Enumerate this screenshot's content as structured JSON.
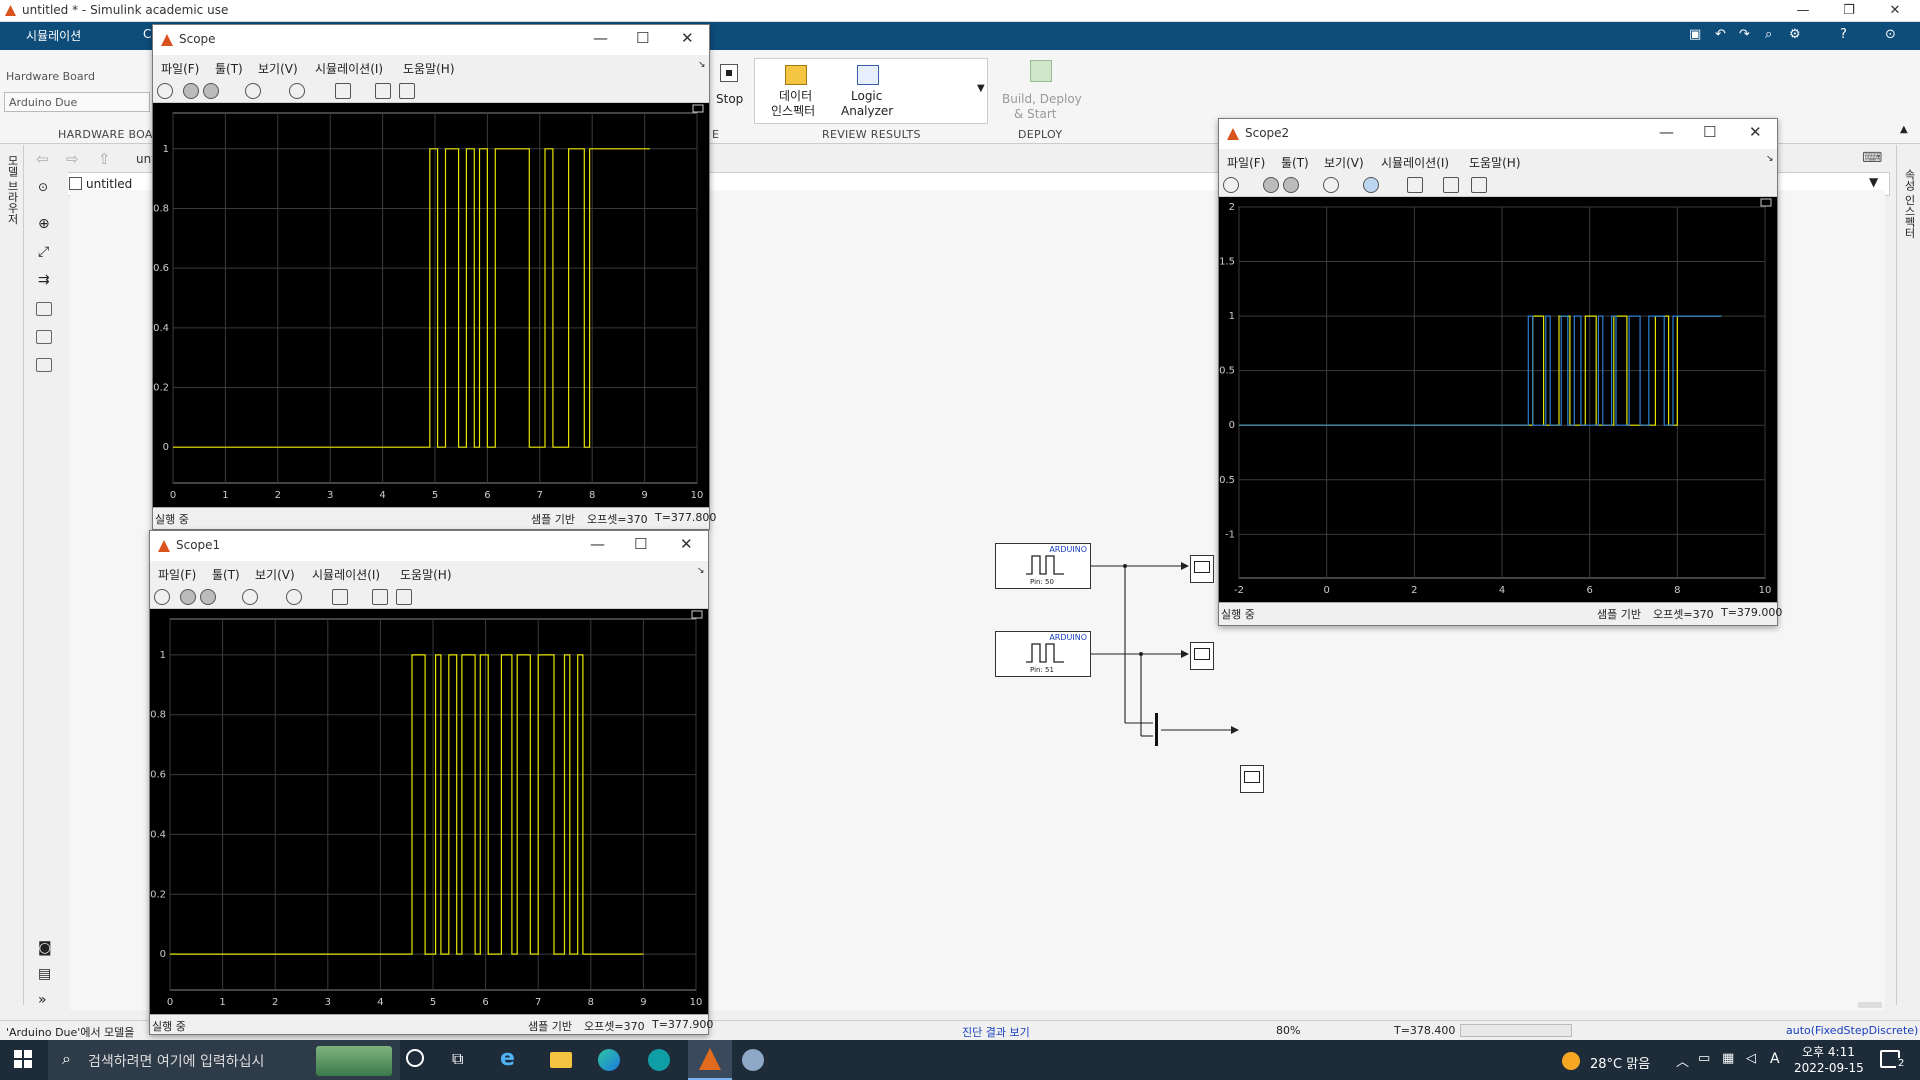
{
  "app": {
    "title": "untitled * - Simulink academic use"
  },
  "ribbon": {
    "tabs": [
      "시뮬레이션",
      "C"
    ],
    "hardware_board_label": "Hardware Board",
    "hardware_board_value": "Arduino Due",
    "hardware_section": "HARDWARE BOA",
    "stop_label": "Stop",
    "data_inspector_line1": "데이터",
    "data_inspector_line2": "인스펙터",
    "logic_analyzer_line1": "Logic",
    "logic_analyzer_line2": "Analyzer",
    "review_section": "REVIEW RESULTS",
    "build_line1": "Build, Deploy",
    "build_line2": "& Start",
    "deploy_section": "DEPLOY",
    "pipe_section": "E"
  },
  "left_rail_text": "모델 브라우저",
  "right_rail_text": "속성 인스펙터",
  "address": {
    "crumb": "untitled",
    "crumb_top": "unt"
  },
  "status": {
    "message": "'Arduino Due'에서 모델을",
    "diagnostics": "진단 결과 보기",
    "zoom": "80%",
    "time": "T=378.400",
    "solver": "auto(FixedStepDiscrete)"
  },
  "menus": [
    "파일(F)",
    "툴(T)",
    "보기(V)",
    "시뮬레이션(I)",
    "도움말(H)"
  ],
  "scope": {
    "title": "Scope",
    "status": "실행 중",
    "sample": "샘플 기반",
    "offset": "오프셋=370",
    "time": "T=377.800",
    "xticks": [
      "0",
      "1",
      "2",
      "3",
      "4",
      "5",
      "6",
      "7",
      "8",
      "9",
      "10"
    ],
    "yticks": [
      "0",
      "0.2",
      "0.4",
      "0.6",
      "0.8",
      "1"
    ]
  },
  "scope1": {
    "title": "Scope1",
    "status": "실행 중",
    "sample": "샘플 기반",
    "offset": "오프셋=370",
    "time": "T=377.900",
    "xticks": [
      "0",
      "1",
      "2",
      "3",
      "4",
      "5",
      "6",
      "7",
      "8",
      "9",
      "10"
    ],
    "yticks": [
      "0",
      "0.2",
      "0.4",
      "0.6",
      "0.8",
      "1"
    ]
  },
  "scope2": {
    "title": "Scope2",
    "status": "실행 중",
    "sample": "샘플 기반",
    "offset": "오프셋=370",
    "time": "T=379.000",
    "xticks": [
      "-2",
      "0",
      "2",
      "4",
      "6",
      "8",
      "10"
    ],
    "yticks": [
      "-1",
      "-0.5",
      "0",
      "0.5",
      "1",
      "1.5",
      "2"
    ]
  },
  "blocks": {
    "b1_tag": "ARDUINO",
    "b1_pin": "Pin: 50",
    "b2_tag": "ARDUINO",
    "b2_pin": "Pin: 51"
  },
  "taskbar": {
    "search_placeholder": "검색하려면 여기에 입력하십시",
    "weather": "28°C 맑음",
    "ime": "A",
    "clock_time": "오후 4:11",
    "clock_date": "2022-09-15",
    "notif_count": "2"
  },
  "chart_data": [
    {
      "type": "line",
      "title": "",
      "xlabel": "",
      "ylabel": "",
      "xlim": [
        0,
        10
      ],
      "ylim": [
        -0.12,
        1.12
      ],
      "grid": true,
      "series": [
        {
          "name": "",
          "color": "#e6e600",
          "x": [
            0,
            4.9,
            4.9,
            5.05,
            5.05,
            5.2,
            5.2,
            5.45,
            5.45,
            5.6,
            5.6,
            5.75,
            5.75,
            5.85,
            5.85,
            6.0,
            6.0,
            6.15,
            6.15,
            6.8,
            6.8,
            7.1,
            7.1,
            7.25,
            7.25,
            7.55,
            7.55,
            7.85,
            7.85,
            7.95,
            7.95,
            9.1
          ],
          "y": [
            0,
            0,
            1,
            1,
            0,
            0,
            1,
            1,
            0,
            0,
            1,
            1,
            0,
            0,
            1,
            1,
            0,
            0,
            1,
            1,
            0,
            0,
            1,
            1,
            0,
            0,
            1,
            1,
            0,
            0,
            1,
            1
          ]
        }
      ]
    },
    {
      "type": "line",
      "title": "",
      "xlabel": "",
      "ylabel": "",
      "xlim": [
        0,
        10
      ],
      "ylim": [
        -0.12,
        1.12
      ],
      "grid": true,
      "series": [
        {
          "name": "",
          "color": "#e6e600",
          "x": [
            0,
            4.6,
            4.6,
            4.85,
            4.85,
            5.05,
            5.05,
            5.15,
            5.15,
            5.3,
            5.3,
            5.45,
            5.45,
            5.55,
            5.55,
            5.8,
            5.8,
            5.9,
            5.9,
            6.05,
            6.05,
            6.3,
            6.3,
            6.5,
            6.5,
            6.6,
            6.6,
            6.85,
            6.85,
            7.0,
            7.0,
            7.3,
            7.3,
            7.5,
            7.5,
            7.6,
            7.6,
            7.75,
            7.75,
            7.85,
            7.85,
            9.0
          ],
          "y": [
            0,
            0,
            1,
            1,
            0,
            0,
            1,
            1,
            0,
            0,
            1,
            1,
            0,
            0,
            1,
            1,
            0,
            0,
            1,
            1,
            0,
            0,
            1,
            1,
            0,
            0,
            1,
            1,
            0,
            0,
            1,
            1,
            0,
            0,
            1,
            1,
            0,
            0,
            1,
            1,
            0,
            0
          ]
        }
      ]
    },
    {
      "type": "line",
      "title": "",
      "xlabel": "",
      "ylabel": "",
      "xlim": [
        -2,
        10
      ],
      "ylim": [
        -1.4,
        2
      ],
      "grid": true,
      "series": [
        {
          "name": "",
          "color": "#e6e600",
          "x": [
            -2,
            4.7,
            4.7,
            4.95,
            4.95,
            5.3,
            5.3,
            5.55,
            5.55,
            5.9,
            5.9,
            6.15,
            6.15,
            6.55,
            6.55,
            6.85,
            6.85,
            7.5,
            7.5,
            7.8,
            7.8,
            8.0,
            8.0,
            9.0
          ],
          "y": [
            0,
            0,
            1,
            1,
            0,
            0,
            1,
            1,
            0,
            0,
            1,
            1,
            0,
            0,
            1,
            1,
            0,
            0,
            1,
            1,
            0,
            0,
            1,
            1
          ]
        },
        {
          "name": "",
          "color": "#2a7fd4",
          "x": [
            -2,
            4.6,
            4.6,
            4.7,
            4.7,
            5.0,
            5.0,
            5.1,
            5.1,
            5.35,
            5.35,
            5.5,
            5.5,
            5.65,
            5.65,
            5.8,
            5.8,
            6.2,
            6.2,
            6.3,
            6.3,
            6.5,
            6.5,
            6.6,
            6.6,
            6.9,
            6.9,
            7.15,
            7.15,
            7.35,
            7.35,
            7.7,
            7.7,
            7.9,
            7.9,
            9.0
          ],
          "y": [
            0,
            0,
            1,
            1,
            0,
            0,
            1,
            1,
            0,
            0,
            1,
            1,
            0,
            0,
            1,
            1,
            0,
            0,
            1,
            1,
            0,
            0,
            1,
            1,
            0,
            0,
            1,
            1,
            0,
            0,
            1,
            1,
            0,
            0,
            1,
            1
          ]
        }
      ]
    }
  ]
}
